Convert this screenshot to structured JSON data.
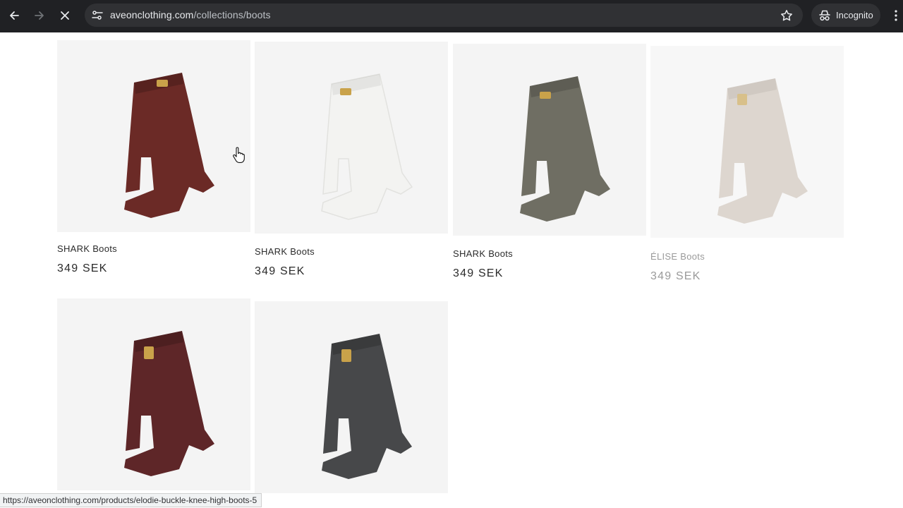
{
  "browser": {
    "url_domain": "aveonclothing.com",
    "url_path": "/collections/boots",
    "incognito_label": "Incognito",
    "status_url": "https://aveonclothing.com/products/elodie-buckle-knee-high-boots-5"
  },
  "products": [
    {
      "title": "SHARK Boots",
      "price": "349 SEK",
      "color": "#6b2a26"
    },
    {
      "title": "SHARK Boots",
      "price": "349 SEK",
      "color": "#f3f3f1"
    },
    {
      "title": "SHARK Boots",
      "price": "349 SEK",
      "color": "#6f6e63"
    },
    {
      "title": "ÉLISE Boots",
      "price": "349 SEK",
      "color": "#ddd6cf"
    },
    {
      "title": "",
      "price": "",
      "color": "#5e2628"
    },
    {
      "title": "",
      "price": "",
      "color": "#47484a"
    }
  ]
}
